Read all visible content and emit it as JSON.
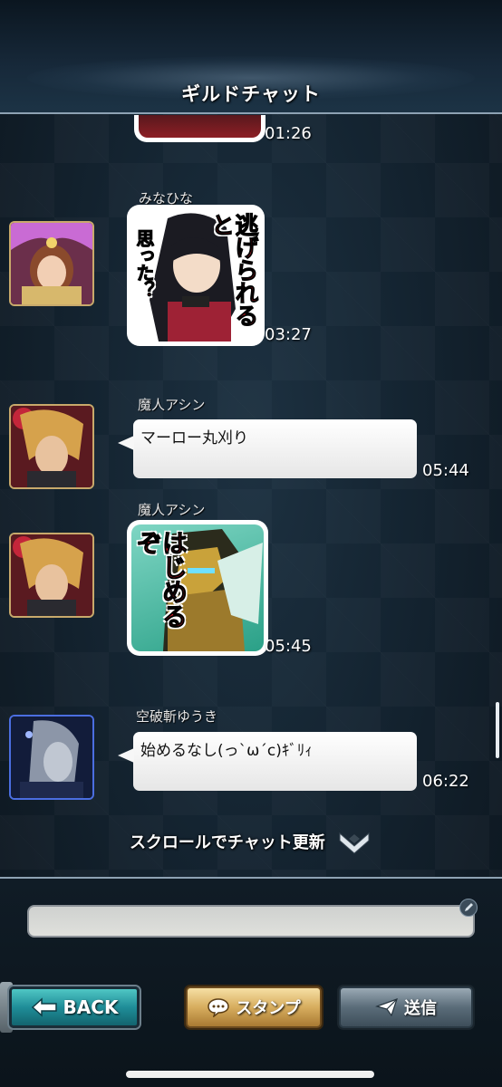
{
  "header": {
    "title": "ギルドチャット"
  },
  "messages": [
    {
      "time": "01:26"
    },
    {
      "user": "みなひな",
      "sticker_text_a": "逃げられると",
      "sticker_text_b": "思った？",
      "time": "03:27"
    },
    {
      "user": "魔人アシン",
      "text": "マーロー丸刈り",
      "time": "05:44"
    },
    {
      "user": "魔人アシン",
      "sticker_text": "はじめるぞ",
      "time": "05:45"
    },
    {
      "user": "空破斬ゆうき",
      "text": "始めるなし(っ`ω´c)ｷﾞﾘｨ",
      "time": "06:22"
    }
  ],
  "refresh_label": "スクロールでチャット更新",
  "input": {
    "value": "",
    "placeholder": ""
  },
  "buttons": {
    "back": "BACK",
    "stamp": "スタンプ",
    "send": "送信"
  },
  "colors": {
    "accent_teal": "#1f8d98",
    "gold": "#d7ad5e",
    "header_line": "#8ea2b3"
  },
  "icons": [
    "back-arrow-icon",
    "speech-bubble-icon",
    "paper-plane-icon",
    "chevron-down-icon",
    "edit-icon"
  ]
}
